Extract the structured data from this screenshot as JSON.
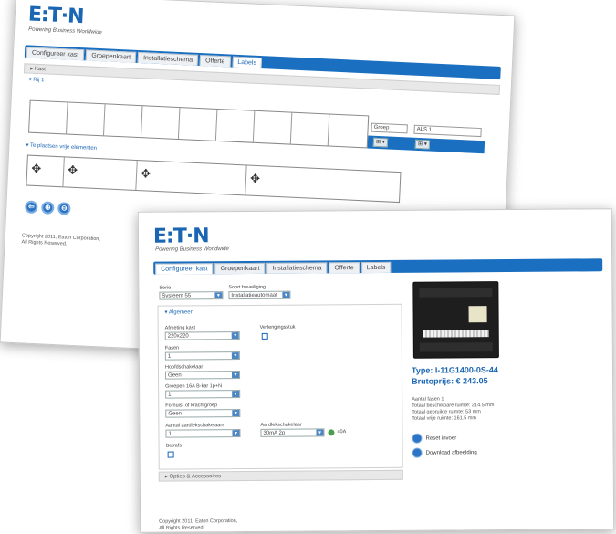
{
  "brand": {
    "logo": "E:T·N",
    "tagline": "Powering Business Worldwide"
  },
  "tabs": [
    "Configureer kast",
    "Groepenkaart",
    "Installatieschema",
    "Offerte",
    "Labels"
  ],
  "back_window": {
    "active_tab": "Labels",
    "section_kast": "▸ Kast",
    "rij": "▾ Rij 1",
    "select_groep": "Groep",
    "select_als": "ALS 1",
    "free_elements": "▾ Te plaatsen vrije elementen",
    "mini_btn": "⊞ ▾",
    "move_icon": "✥",
    "circle_btns": [
      "⇦",
      "⊕",
      "⊖"
    ],
    "copyright_line1": "Copyright 2011, Eaton Corporation,",
    "copyright_line2": "All Rights Reserved."
  },
  "front_window": {
    "active_tab": "Configureer kast",
    "serie_label": "Serie",
    "serie_value": "Systeem 55",
    "beveiliging_label": "Soort beveiliging",
    "beveiliging_value": "Installatieautomaat",
    "algemeen": "▾ Algemeen",
    "afmeting_label": "Afmeting kast",
    "afmeting_value": "220x220",
    "verlenging_label": "Verlengingsstuk",
    "fasen_label": "Fasen",
    "fasen_value": "1",
    "hoofdschakelaar_label": "Hoofdschakelaar",
    "hoofdschakelaar_value": "Geen",
    "groepen_label": "Groepen 16A B-kar 1p+N",
    "groepen_value": "1",
    "fornuis_label": "Fornuis- of krachtgroep",
    "fornuis_value": "Geen",
    "aantal_aard_label": "Aantal aardlekschakelaars",
    "aantal_aard_value": "1",
    "aardlek_label": "Aardlekschakelaar",
    "aardlek_value": "30mA 2p",
    "aardlek_amp": "40A",
    "betrafs_label": "Betrafs",
    "opties": "▸ Opties & Accessoires",
    "type_title": "Type: I-11G1400-0S-44",
    "brutoprijs": "Brutoprijs: € 243.05",
    "info_lines": [
      "Aantal fasen 1",
      "Totaal beschikbare ruimte: 214.5 mm",
      "Totaal gebruikte ruimte: 53 mm",
      "Totaal vrije ruimte: 161.5 mm"
    ],
    "action1": "Reset invoer",
    "action2": "Download afbeelding",
    "copyright_line1": "Copyright 2011, Eaton Corporation,",
    "copyright_line2": "All Rights Reserved."
  },
  "colors": {
    "accent": "#1a6fc0",
    "brand_blue": "#1a66b3",
    "cabinet": "#1e1e1e"
  }
}
